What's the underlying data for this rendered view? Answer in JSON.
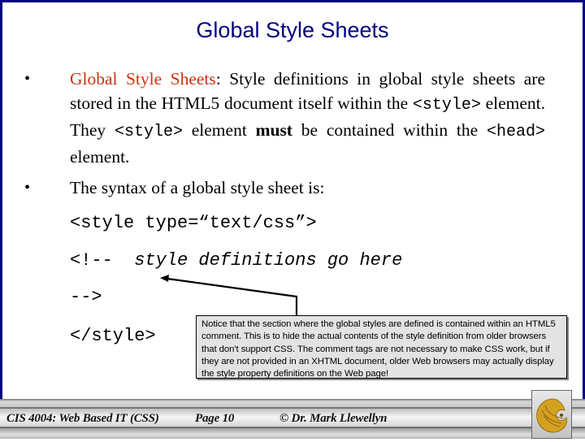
{
  "slide": {
    "title": "Global Style Sheets",
    "bullets": [
      {
        "marker": "•",
        "term": "Global Style Sheets",
        "segments": {
          "after_term": ":  Style definitions in global style sheets are stored in the HTML5 document itself within the ",
          "code1": "<style>",
          "mid1": " element.  They ",
          "code2": "<style>",
          "mid2": " element ",
          "bold": "must",
          "mid3": " be contained within the ",
          "code3": "<head>",
          "end": " element."
        }
      },
      {
        "marker": "•",
        "text": "The syntax of a global style sheet is:"
      }
    ],
    "code_lines": {
      "open_tag": "<style type=“text/css”>",
      "comment_open": "<!--  ",
      "comment_body": "style definitions go here",
      "comment_close": "-->",
      "close_tag": "</style>"
    },
    "callout": "Notice that the section where the global styles are defined is contained within an HTML5 comment.  This is to hide the actual contents of the style definition from older browsers that don't support CSS.  The comment tags are not necessary to make CSS work, but if they are not provided in an XHTML document, older Web browsers may actually display the style property definitions on the Web page!"
  },
  "footer": {
    "course": "CIS 4004: Web Based IT (CSS)",
    "page": "Page 10",
    "author": "© Dr. Mark Llewellyn",
    "logo_icon": "pegasus-logo-icon"
  },
  "colors": {
    "frame": "#00007f",
    "title": "#000080",
    "term_accent": "#cc3311",
    "callout_bg": "#e3e3e3",
    "logo_gold": "#d4a020"
  }
}
